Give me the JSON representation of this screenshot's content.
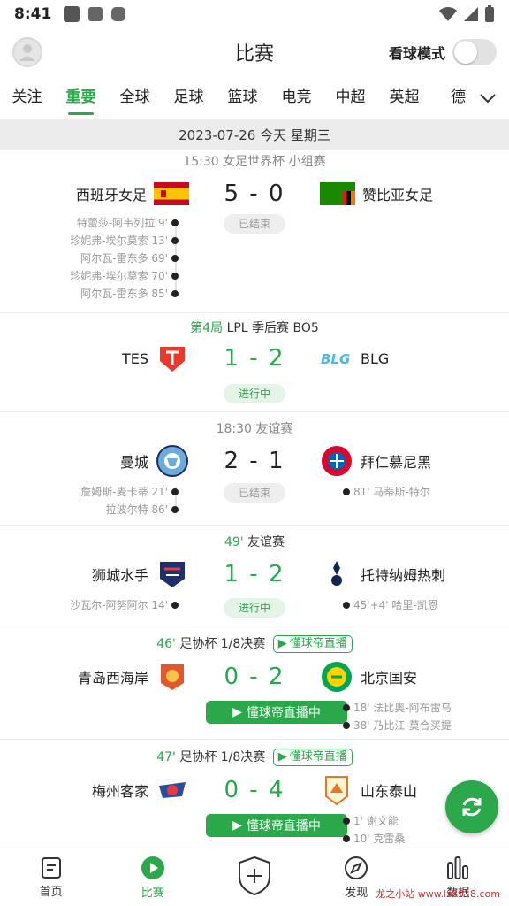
{
  "status_bar": {
    "time": "8:41"
  },
  "header": {
    "title": "比赛",
    "watch_mode_label": "看球模式"
  },
  "tabs": [
    {
      "label": "关注"
    },
    {
      "label": "重要",
      "active": true
    },
    {
      "label": "全球"
    },
    {
      "label": "足球"
    },
    {
      "label": "篮球"
    },
    {
      "label": "电竞"
    },
    {
      "label": "中超"
    },
    {
      "label": "英超"
    },
    {
      "label": "德"
    }
  ],
  "date_bar": "2023-07-26 今天 星期三",
  "matches": [
    {
      "time": "15:30",
      "competition": "女足世界杯 小组赛",
      "home": "西班牙女足",
      "away": "赞比亚女足",
      "score": "5 - 0",
      "status": "已结束",
      "home_events": [
        "特蕾莎-阿韦列拉 9'",
        "珍妮弗-埃尔莫索 13'",
        "阿尔瓦-雷东多 69'",
        "珍妮弗-埃尔莫索 70'",
        "阿尔瓦-雷东多 85'"
      ]
    },
    {
      "round": "第4局",
      "competition": "LPL 季后赛 BO5",
      "home": "TES",
      "away": "BLG",
      "score": "1 - 2",
      "status": "进行中"
    },
    {
      "time": "18:30",
      "competition": "友谊赛",
      "home": "曼城",
      "away": "拜仁慕尼黑",
      "score": "2 - 1",
      "status": "已结束",
      "home_events": [
        "詹姆斯-麦卡蒂 21'",
        "拉波尔特 86'"
      ],
      "away_events": [
        "81' 马蒂斯-特尔"
      ]
    },
    {
      "minute": "49'",
      "competition": "友谊赛",
      "home": "狮城水手",
      "away": "托特纳姆热刺",
      "score": "1 - 2",
      "status": "进行中",
      "home_events": [
        "沙瓦尔-阿努阿尔 14'"
      ],
      "away_events": [
        "45'+4' 哈里-凯恩"
      ]
    },
    {
      "minute": "46'",
      "competition": "足协杯 1/8决赛",
      "live_tag": "懂球帝直播",
      "home": "青岛西海岸",
      "away": "北京国安",
      "score": "0 - 2",
      "live_button": "懂球帝直播中",
      "away_events": [
        "18' 法比奥-阿布雷乌",
        "38' 乃比江-莫合买提"
      ]
    },
    {
      "minute": "47'",
      "competition": "足协杯 1/8决赛",
      "live_tag": "懂球帝直播",
      "home": "梅州客家",
      "away": "山东泰山",
      "score": "0 - 4",
      "live_button": "懂球帝直播中",
      "away_events": [
        "1' 谢文能",
        "10' 克雷桑"
      ]
    }
  ],
  "bottom_nav": [
    {
      "label": "首页"
    },
    {
      "label": "比赛",
      "active": true
    },
    {
      "label": ""
    },
    {
      "label": "发现"
    },
    {
      "label": "数据"
    }
  ],
  "watermark": "龙之小站 www.lz8918.com",
  "colors": {
    "accent": "#2aa84a"
  }
}
